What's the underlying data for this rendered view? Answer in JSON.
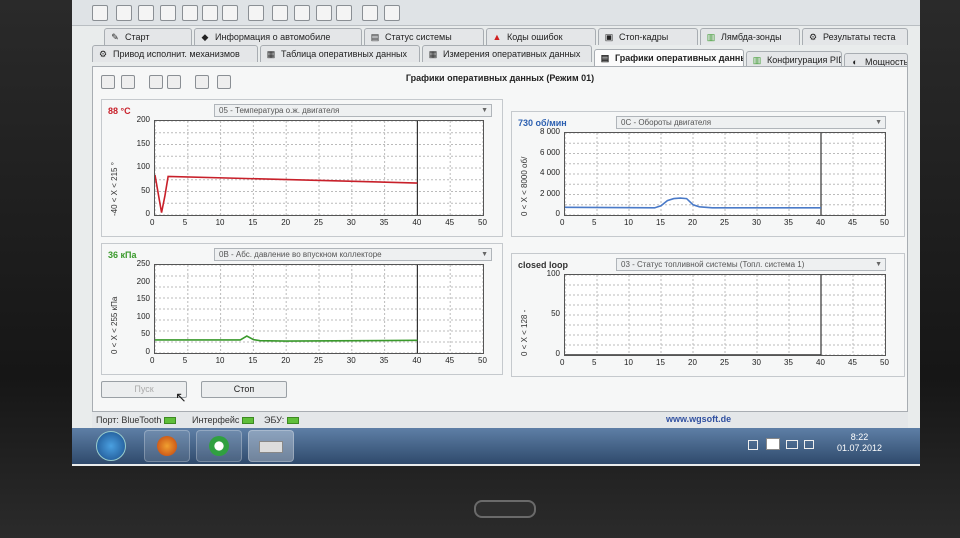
{
  "panel_title": "Графики оперативных данных (Режим 01)",
  "tabs_row1": [
    {
      "label": "Старт",
      "icon": "start-icon"
    },
    {
      "label": "Информация о автомобиле",
      "icon": "car-info-icon"
    },
    {
      "label": "Статус системы",
      "icon": "system-status-icon"
    },
    {
      "label": "Коды ошибок",
      "icon": "warning-icon"
    },
    {
      "label": "Стоп-кадры",
      "icon": "freeze-frame-icon"
    },
    {
      "label": "Лямбда-зонды",
      "icon": "lambda-icon"
    },
    {
      "label": "Результаты теста",
      "icon": "test-results-icon"
    }
  ],
  "tabs_row2": [
    {
      "label": "Привод исполнит. механизмов",
      "icon": "actuator-icon"
    },
    {
      "label": "Таблица оперативных данных",
      "icon": "table-icon"
    },
    {
      "label": "Измерения оперативных данных",
      "icon": "measure-icon"
    },
    {
      "label": "Графики оперативных данных",
      "icon": "graph-icon"
    },
    {
      "label": "Конфигурация PID",
      "icon": "pid-config-icon"
    },
    {
      "label": "Мощность",
      "icon": "power-icon"
    }
  ],
  "charts": [
    {
      "value": "88 °C",
      "value_color": "#c8202a",
      "select": "05 - Температура о.ж. двигателя",
      "yrange": "-40 < X < 215 °",
      "line_color": "#c8202a",
      "chart_data": {
        "type": "line",
        "x": [
          0,
          1,
          1.5,
          2,
          40
        ],
        "y": [
          85,
          5,
          40,
          82,
          68
        ],
        "xlim": [
          0,
          50
        ],
        "ylim": [
          0,
          200
        ],
        "xticks": [
          "0",
          "5",
          "10",
          "15",
          "20",
          "25",
          "30",
          "35",
          "40",
          "45",
          "50"
        ],
        "yticks": [
          "200",
          "150",
          "100",
          "50",
          "0"
        ]
      }
    },
    {
      "value": "730 об/мин",
      "value_color": "#2b5fb0",
      "select": "0C - Обороты двигателя",
      "yrange": "0 < X < 8000 об/",
      "line_color": "#4a7ac8",
      "chart_data": {
        "type": "line",
        "x": [
          0,
          14,
          15,
          16,
          17,
          18,
          19,
          20,
          21,
          23,
          40
        ],
        "y": [
          750,
          700,
          900,
          1400,
          1600,
          1650,
          1600,
          1000,
          800,
          700,
          700
        ],
        "xlim": [
          0,
          50
        ],
        "ylim": [
          0,
          8000
        ],
        "xticks": [
          "0",
          "5",
          "10",
          "15",
          "20",
          "25",
          "30",
          "35",
          "40",
          "45",
          "50"
        ],
        "yticks": [
          "8 000",
          "6 000",
          "4 000",
          "2 000",
          "0"
        ]
      }
    },
    {
      "value": "36 кПа",
      "value_color": "#3a9a2c",
      "select": "0B - Абс. давление во впускном коллекторе",
      "yrange": "0 < X < 255 кПа",
      "line_color": "#3a9a2c",
      "chart_data": {
        "type": "line",
        "x": [
          0,
          13,
          14,
          15,
          16,
          20,
          40
        ],
        "y": [
          37,
          37,
          48,
          38,
          35,
          34,
          36
        ],
        "xlim": [
          0,
          50
        ],
        "ylim": [
          0,
          250
        ],
        "xticks": [
          "0",
          "5",
          "10",
          "15",
          "20",
          "25",
          "30",
          "35",
          "40",
          "45",
          "50"
        ],
        "yticks": [
          "250",
          "200",
          "150",
          "100",
          "50",
          "0"
        ]
      }
    },
    {
      "value": "closed loop",
      "value_color": "#333333",
      "select": "03 - Статус топливной системы (Топл. система 1)",
      "yrange": "0 < X < 128 -",
      "line_color": "#333333",
      "chart_data": {
        "type": "line",
        "x": [
          0,
          40
        ],
        "y": [
          0,
          0
        ],
        "xlim": [
          0,
          50
        ],
        "ylim": [
          0,
          100
        ],
        "xticks": [
          "0",
          "5",
          "10",
          "15",
          "20",
          "25",
          "30",
          "35",
          "40",
          "45",
          "50"
        ],
        "yticks": [
          "100",
          "50",
          "0"
        ]
      }
    }
  ],
  "buttons": {
    "start": "Пуск",
    "stop": "Стоп"
  },
  "status": {
    "port": "Порт: BlueTooth",
    "interface": "Интерфейс",
    "ecu": "ЭБУ:",
    "link": "www.wgsoft.de"
  },
  "clock": {
    "time": "8:22",
    "date": "01.07.2012"
  }
}
